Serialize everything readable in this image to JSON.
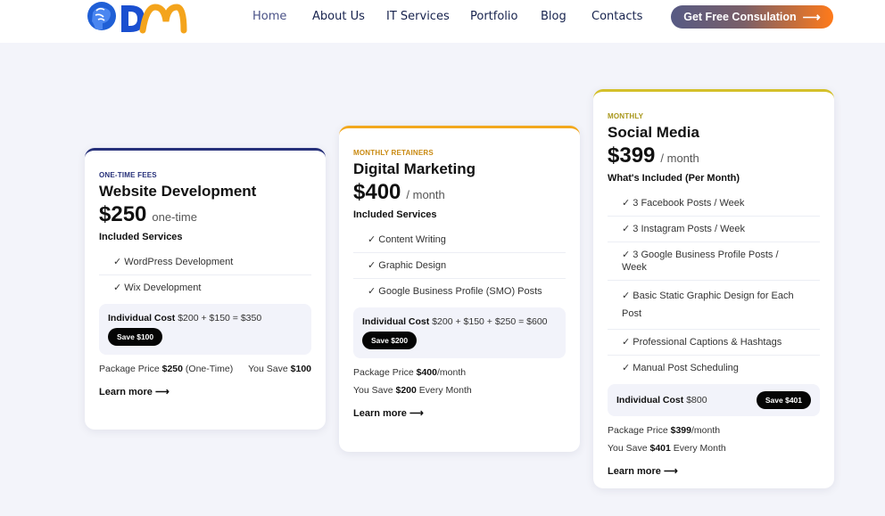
{
  "nav": {
    "items": [
      "Home",
      "About Us",
      "IT Services",
      "Portfolio",
      "Blog",
      "Contacts"
    ],
    "cta": "Get Free Consulation",
    "cta_icon": "arrow-right-icon",
    "logo_icon": "brain-head-icon",
    "active_color": "#4a5287",
    "text_color": "#17234e"
  },
  "cards": [
    {
      "eyebrow": "ONE-TIME FEES",
      "title": "Website Development",
      "price": "$250",
      "unit": "one-time",
      "section": "Included Services",
      "services": [
        "✓ WordPress Development",
        "✓ Wix Development"
      ],
      "cost_label": "Individual Cost",
      "cost_value": "$200 + $150 = $350",
      "save": "Save $100",
      "pkg_label": "Package Price",
      "pkg_value": "$250",
      "pkg_suffix": "(One-Time)",
      "you_save_label": "You Save",
      "you_save_value": "$100",
      "learn": "Learn more ⟶",
      "accent": "#27317a",
      "eyebrow_color": "#27317a"
    },
    {
      "eyebrow": "MONTHLY RETAINERS",
      "title": "Digital Marketing",
      "price": "$400",
      "unit": "/ month",
      "section": "Included Services",
      "services": [
        "✓ Content Writing",
        "✓ Graphic Design",
        "✓ Google Business Profile (SMO) Posts"
      ],
      "cost_label": "Individual Cost",
      "cost_value": "$200 + $150 + $250 = $600",
      "save": "Save $200",
      "pkg_label": "Package Price",
      "pkg_value": "$400",
      "pkg_suffix": "/month",
      "you_save_label": "You Save",
      "you_save_value": "$200",
      "you_save_suffix": "Every Month",
      "learn": "Learn more ⟶",
      "accent": "#f2a81d",
      "eyebrow_color": "#c98a12"
    },
    {
      "eyebrow": "MONTHLY",
      "title": "Social Media",
      "price": "$399",
      "unit": "/ month",
      "section": "What's Included (Per Month)",
      "services": [
        "✓ 3 Facebook Posts / Week",
        "✓ 3 Instagram Posts / Week",
        "✓ 3 Google Business Profile Posts / Week",
        "✓ Basic Static Graphic Design for Each Post",
        "✓ Professional Captions & Hashtags",
        "✓ Manual Post Scheduling"
      ],
      "cost_label": "Individual Cost",
      "cost_value": "$800",
      "save": "Save $401",
      "pkg_label": "Package Price",
      "pkg_value": "$399",
      "pkg_suffix": "/month",
      "you_save_label": "You Save",
      "you_save_value": "$401",
      "you_save_suffix": "Every Month",
      "learn": "Learn more ⟶",
      "accent": "#d4c02a",
      "eyebrow_color": "#a8961a"
    }
  ]
}
